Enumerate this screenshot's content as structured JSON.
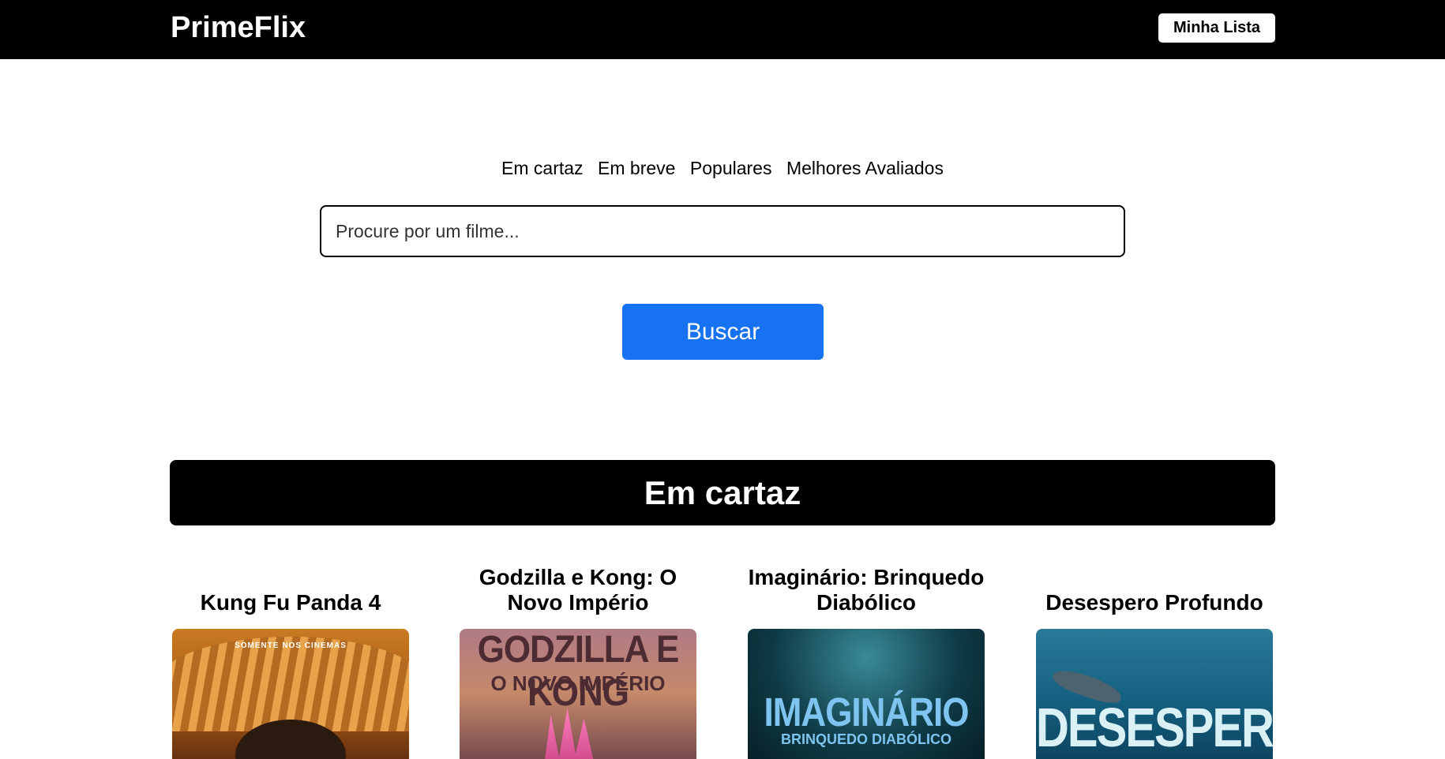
{
  "header": {
    "brand": "PrimeFlix",
    "my_list_label": "Minha Lista"
  },
  "nav": {
    "categories": [
      "Em cartaz",
      "Em breve",
      "Populares",
      "Melhores Avaliados"
    ]
  },
  "search": {
    "placeholder": "Procure por um filme...",
    "value": "",
    "button_label": "Buscar"
  },
  "section": {
    "title": "Em cartaz"
  },
  "movies": [
    {
      "title": "Kung Fu Panda 4",
      "poster_text": "SOMENTE NOS CINEMAS"
    },
    {
      "title": "Godzilla e Kong: O Novo Império",
      "poster_text": "GODZILLA E KONG",
      "poster_subtext": "O NOVO IMPÉRIO"
    },
    {
      "title": "Imaginário: Brinquedo Diabólico",
      "poster_text": "IMAGINÁRIO",
      "poster_subtext": "BRINQUEDO DIABÓLICO"
    },
    {
      "title": "Desespero Profundo",
      "poster_text": "DESESPERO"
    }
  ],
  "colors": {
    "header_bg": "#000000",
    "accent_button": "#1672f0",
    "section_bar": "#000000"
  }
}
